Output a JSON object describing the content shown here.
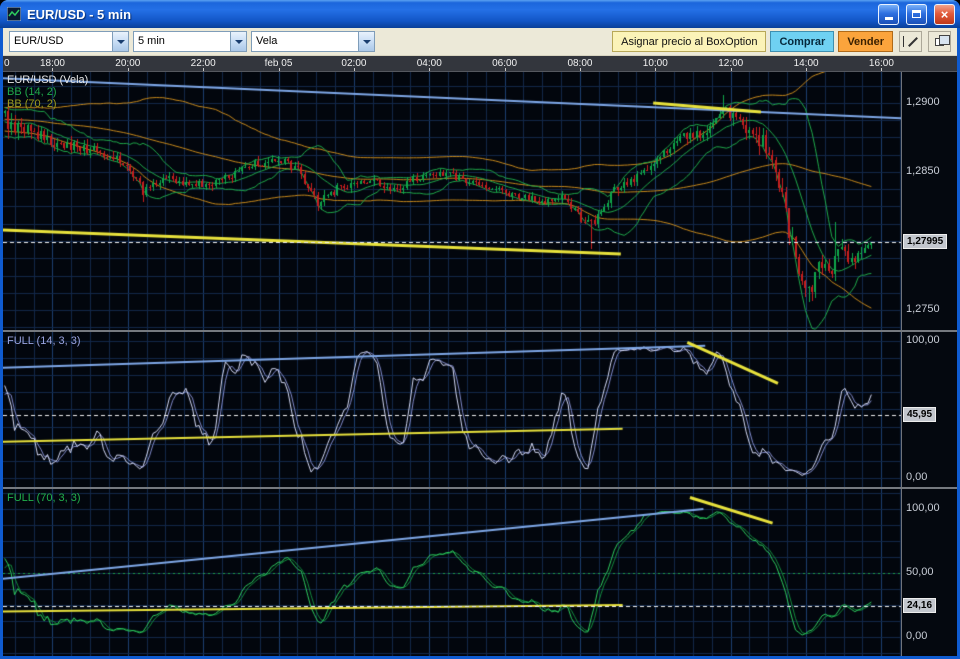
{
  "window": {
    "title": "EUR/USD - 5 min",
    "close_label": "×"
  },
  "toolbar": {
    "symbol": {
      "value": "EUR/USD"
    },
    "interval": {
      "value": "5 min"
    },
    "chart_type": {
      "value": "Vela"
    },
    "assign_box_option": "Asignar precio al BoxOption",
    "buy": "Comprar",
    "sell": "Vender",
    "icons": [
      "chevron-down-icon",
      "cursor-line-tools-icon",
      "cascade-windows-icon"
    ],
    "colors": {
      "buy_bg": "#6FD1F2",
      "sell_bg": "#FBA43C",
      "assign_bg": "#FBF3B8"
    }
  },
  "time_axis": {
    "labels": [
      {
        "text": "0",
        "f": 0.0,
        "cut": true
      },
      {
        "text": "18:00",
        "f": 0.0551
      },
      {
        "text": "20:00",
        "f": 0.139
      },
      {
        "text": "22:00",
        "f": 0.2229
      },
      {
        "text": "feb 05",
        "f": 0.3068
      },
      {
        "text": "02:00",
        "f": 0.3908
      },
      {
        "text": "04:00",
        "f": 0.4747
      },
      {
        "text": "06:00",
        "f": 0.5586
      },
      {
        "text": "08:00",
        "f": 0.6425
      },
      {
        "text": "10:00",
        "f": 0.7264
      },
      {
        "text": "12:00",
        "f": 0.8104
      },
      {
        "text": "14:00",
        "f": 0.8943
      },
      {
        "text": "16:00",
        "f": 0.9782
      }
    ]
  },
  "colors": {
    "chart_bg": "#02060D",
    "grid_minor": "#12284A",
    "grid_major": "#1C3E70",
    "axis_text": "#C8CDD6",
    "dashed_line": "#F0F0F0",
    "separator": "#75797F",
    "trend_blue": "#7FA8E8",
    "trend_yellow": "#E8E23C"
  },
  "chart_data": [
    {
      "type": "candlestick",
      "symbol": "EUR/USD",
      "interval": "5 min",
      "title": "EUR/USD (Vela)",
      "series_labels": [
        "EUR/USD (Vela)",
        "BB (14, 2)",
        "BB (70, 2)"
      ],
      "label_colors": [
        "#E8E8E8",
        "#1FA94A",
        "#9C9C1E"
      ],
      "up_color": "#0FA64A",
      "down_color": "#C81E1E",
      "bb14_color": "#1FA94A",
      "bb70_color": "#C98A1B",
      "visible_candles": 264,
      "lead_in_candles": 80,
      "seed": 13,
      "final_close": 1.27995,
      "price_path_keypoints": [
        [
          -0.3,
          1.2897
        ],
        [
          -0.26,
          1.2888
        ],
        [
          -0.22,
          1.2895
        ],
        [
          -0.18,
          1.2884
        ],
        [
          -0.14,
          1.2892
        ],
        [
          -0.1,
          1.2882
        ],
        [
          -0.06,
          1.289
        ],
        [
          -0.03,
          1.2884
        ],
        [
          0.0,
          1.2888
        ],
        [
          0.03,
          1.2879
        ],
        [
          0.055,
          1.2872
        ],
        [
          0.08,
          1.2869
        ],
        [
          0.11,
          1.2864
        ],
        [
          0.137,
          1.2858
        ],
        [
          0.16,
          1.2836
        ],
        [
          0.182,
          1.2846
        ],
        [
          0.216,
          1.2841
        ],
        [
          0.249,
          1.2843
        ],
        [
          0.283,
          1.2855
        ],
        [
          0.317,
          1.286
        ],
        [
          0.339,
          1.285
        ],
        [
          0.362,
          1.2827
        ],
        [
          0.39,
          1.284
        ],
        [
          0.424,
          1.2843
        ],
        [
          0.457,
          1.2838
        ],
        [
          0.474,
          1.2846
        ],
        [
          0.508,
          1.2849
        ],
        [
          0.542,
          1.2841
        ],
        [
          0.558,
          1.2838
        ],
        [
          0.592,
          1.2833
        ],
        [
          0.626,
          1.2828
        ],
        [
          0.643,
          1.2831
        ],
        [
          0.663,
          1.2818
        ],
        [
          0.676,
          1.2812
        ],
        [
          0.704,
          1.2836
        ],
        [
          0.727,
          1.2846
        ],
        [
          0.755,
          1.2861
        ],
        [
          0.783,
          1.2876
        ],
        [
          0.81,
          1.2879
        ],
        [
          0.828,
          1.2896
        ],
        [
          0.845,
          1.2886
        ],
        [
          0.862,
          1.2876
        ],
        [
          0.879,
          1.2869
        ],
        [
          0.894,
          1.2841
        ],
        [
          0.907,
          1.2801
        ],
        [
          0.918,
          1.2779
        ],
        [
          0.929,
          1.2763
        ],
        [
          0.94,
          1.2786
        ],
        [
          0.952,
          1.2776
        ],
        [
          0.963,
          1.2796
        ],
        [
          0.974,
          1.2783
        ],
        [
          0.985,
          1.2791
        ],
        [
          1.0,
          1.27995
        ]
      ],
      "volatility_keypoints": [
        [
          -0.3,
          0.0006
        ],
        [
          0.0,
          0.0013
        ],
        [
          0.05,
          0.0008
        ],
        [
          0.2,
          0.00055
        ],
        [
          0.35,
          0.0007
        ],
        [
          0.5,
          0.0005
        ],
        [
          0.62,
          0.00055
        ],
        [
          0.68,
          0.0007
        ],
        [
          0.75,
          0.0006
        ],
        [
          0.83,
          0.0009
        ],
        [
          0.9,
          0.0013
        ],
        [
          0.94,
          0.0011
        ],
        [
          1.0,
          0.0008
        ]
      ],
      "spikes": [
        {
          "f": 0.16,
          "low": 1.2828
        },
        {
          "f": 0.676,
          "low": 1.2794
        },
        {
          "f": 0.828,
          "high": 1.2906
        },
        {
          "f": 0.929,
          "low": 1.2756
        },
        {
          "f": 0.957,
          "high": 1.2814
        }
      ],
      "y_axis": {
        "top_value": 1.292246,
        "bottom_value": 1.273551,
        "grid_step": 0.00125,
        "ticks": [
          {
            "label": "1,2900",
            "value": 1.29
          },
          {
            "label": "1,2850",
            "value": 1.285
          },
          {
            "label": "1,2750",
            "value": 1.275
          }
        ],
        "current": {
          "label": "1,27995",
          "value": 1.27995
        }
      },
      "trendlines": [
        {
          "color": "#7FA8E8",
          "width": 2,
          "x1": 0.0,
          "v1": 1.2918,
          "x2": 1.0,
          "v2": 1.2889
        },
        {
          "color": "#E8E23C",
          "width": 3,
          "x1": 0.724,
          "v1": 1.29,
          "x2": 0.844,
          "v2": 1.28935
        },
        {
          "color": "#E8E23C",
          "width": 3,
          "x1": 0.0,
          "v1": 1.2808,
          "x2": 0.688,
          "v2": 1.27906
        }
      ],
      "current_line": {
        "value": 1.27995,
        "style": "dashed",
        "color": "#F0F0F0"
      }
    },
    {
      "type": "line",
      "title": "FULL (14, 3, 3)",
      "indicator": "Stochastic Full",
      "params": [
        14,
        3,
        3
      ],
      "k_color": "#D4D9F5",
      "d_color": "#8089C9",
      "label_color": "#9AA4E0",
      "y_axis": {
        "top_value": 105.84,
        "bottom_value": -6.57,
        "grid_step": 12.5,
        "ticks": [
          {
            "label": "100,00",
            "value": 100
          },
          {
            "label": "0,00",
            "value": 0
          }
        ],
        "current": {
          "label": "45,95",
          "value": 45.95
        }
      },
      "trendlines": [
        {
          "color": "#7FA8E8",
          "width": 2,
          "x1": 0.0,
          "v1": 80.5,
          "x2": 0.782,
          "v2": 96.5
        },
        {
          "color": "#E8E23C",
          "width": 2,
          "x1": 0.0,
          "v1": 26.5,
          "x2": 0.69,
          "v2": 36.0
        },
        {
          "color": "#E8E23C",
          "width": 3,
          "x1": 0.762,
          "v1": 99.0,
          "x2": 0.863,
          "v2": 69.0
        }
      ],
      "current_line": {
        "value": 45.95,
        "style": "dashed",
        "color": "#F0F0F0"
      }
    },
    {
      "type": "line",
      "title": "FULL (70, 3, 3)",
      "indicator": "Stochastic Full",
      "params": [
        70,
        3,
        3
      ],
      "k_color": "#2ECC5E",
      "d_color": "#128A3C",
      "label_color": "#21B14C",
      "y_axis": {
        "top_value": 114.84,
        "bottom_value": -14.84,
        "grid_step": 12.5,
        "ticks": [
          {
            "label": "100,00",
            "value": 100
          },
          {
            "label": "50,00",
            "value": 50
          },
          {
            "label": "0,00",
            "value": 0
          }
        ],
        "current": {
          "label": "24,16",
          "value": 24.16
        }
      },
      "reference_line": {
        "value": 50,
        "color": "#1DA14A",
        "style": "dotted"
      },
      "trendlines": [
        {
          "color": "#7FA8E8",
          "width": 2,
          "x1": 0.0,
          "v1": 45.5,
          "x2": 0.78,
          "v2": 100.0
        },
        {
          "color": "#E8E23C",
          "width": 2,
          "x1": 0.0,
          "v1": 20.0,
          "x2": 0.69,
          "v2": 25.0
        },
        {
          "color": "#E8E23C",
          "width": 3,
          "x1": 0.765,
          "v1": 109.0,
          "x2": 0.857,
          "v2": 89.0
        }
      ],
      "current_line": {
        "value": 24.16,
        "style": "dashed",
        "color": "#F0F0F0"
      }
    }
  ]
}
